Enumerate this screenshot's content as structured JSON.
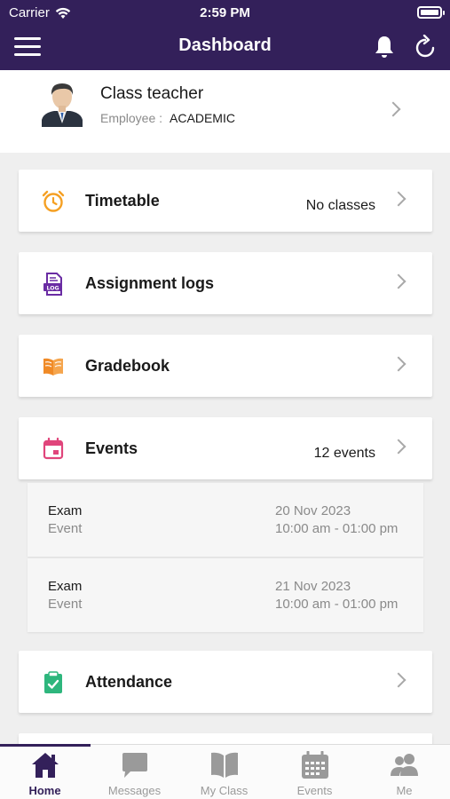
{
  "status_bar": {
    "carrier": "Carrier",
    "time": "2:59 PM"
  },
  "header": {
    "title": "Dashboard"
  },
  "profile": {
    "name": "Class teacher",
    "role_label": "Employee :",
    "role_value": "ACADEMIC"
  },
  "cards": {
    "timetable": {
      "label": "Timetable",
      "value": "No classes",
      "icon": "alarm-clock-icon",
      "icon_color": "#f5a023"
    },
    "assignment": {
      "label": "Assignment logs",
      "icon": "log-file-icon",
      "icon_color": "#6a2ca3"
    },
    "gradebook": {
      "label": "Gradebook",
      "icon": "open-book-icon",
      "icon_color": "#f08a26"
    },
    "events": {
      "label": "Events",
      "value": "12 events",
      "icon": "calendar-icon",
      "icon_color": "#e0457b"
    },
    "attendance": {
      "label": "Attendance",
      "icon": "clipboard-check-icon",
      "icon_color": "#2eb67d"
    }
  },
  "events": [
    {
      "title": "Exam",
      "type": "Event",
      "date": "20 Nov 2023",
      "time": "10:00 am - 01:00 pm"
    },
    {
      "title": "Exam",
      "type": "Event",
      "date": "21 Nov 2023",
      "time": "10:00 am - 01:00 pm"
    }
  ],
  "tabs": [
    {
      "label": "Home",
      "icon": "home-icon",
      "active": true
    },
    {
      "label": "Messages",
      "icon": "chat-bubble-icon"
    },
    {
      "label": "My Class",
      "icon": "book-icon"
    },
    {
      "label": "Events",
      "icon": "calendar-icon"
    },
    {
      "label": "Me",
      "icon": "people-icon"
    }
  ],
  "colors": {
    "primary": "#33205a",
    "background": "#efefef",
    "inactive": "#9a9a9a"
  }
}
